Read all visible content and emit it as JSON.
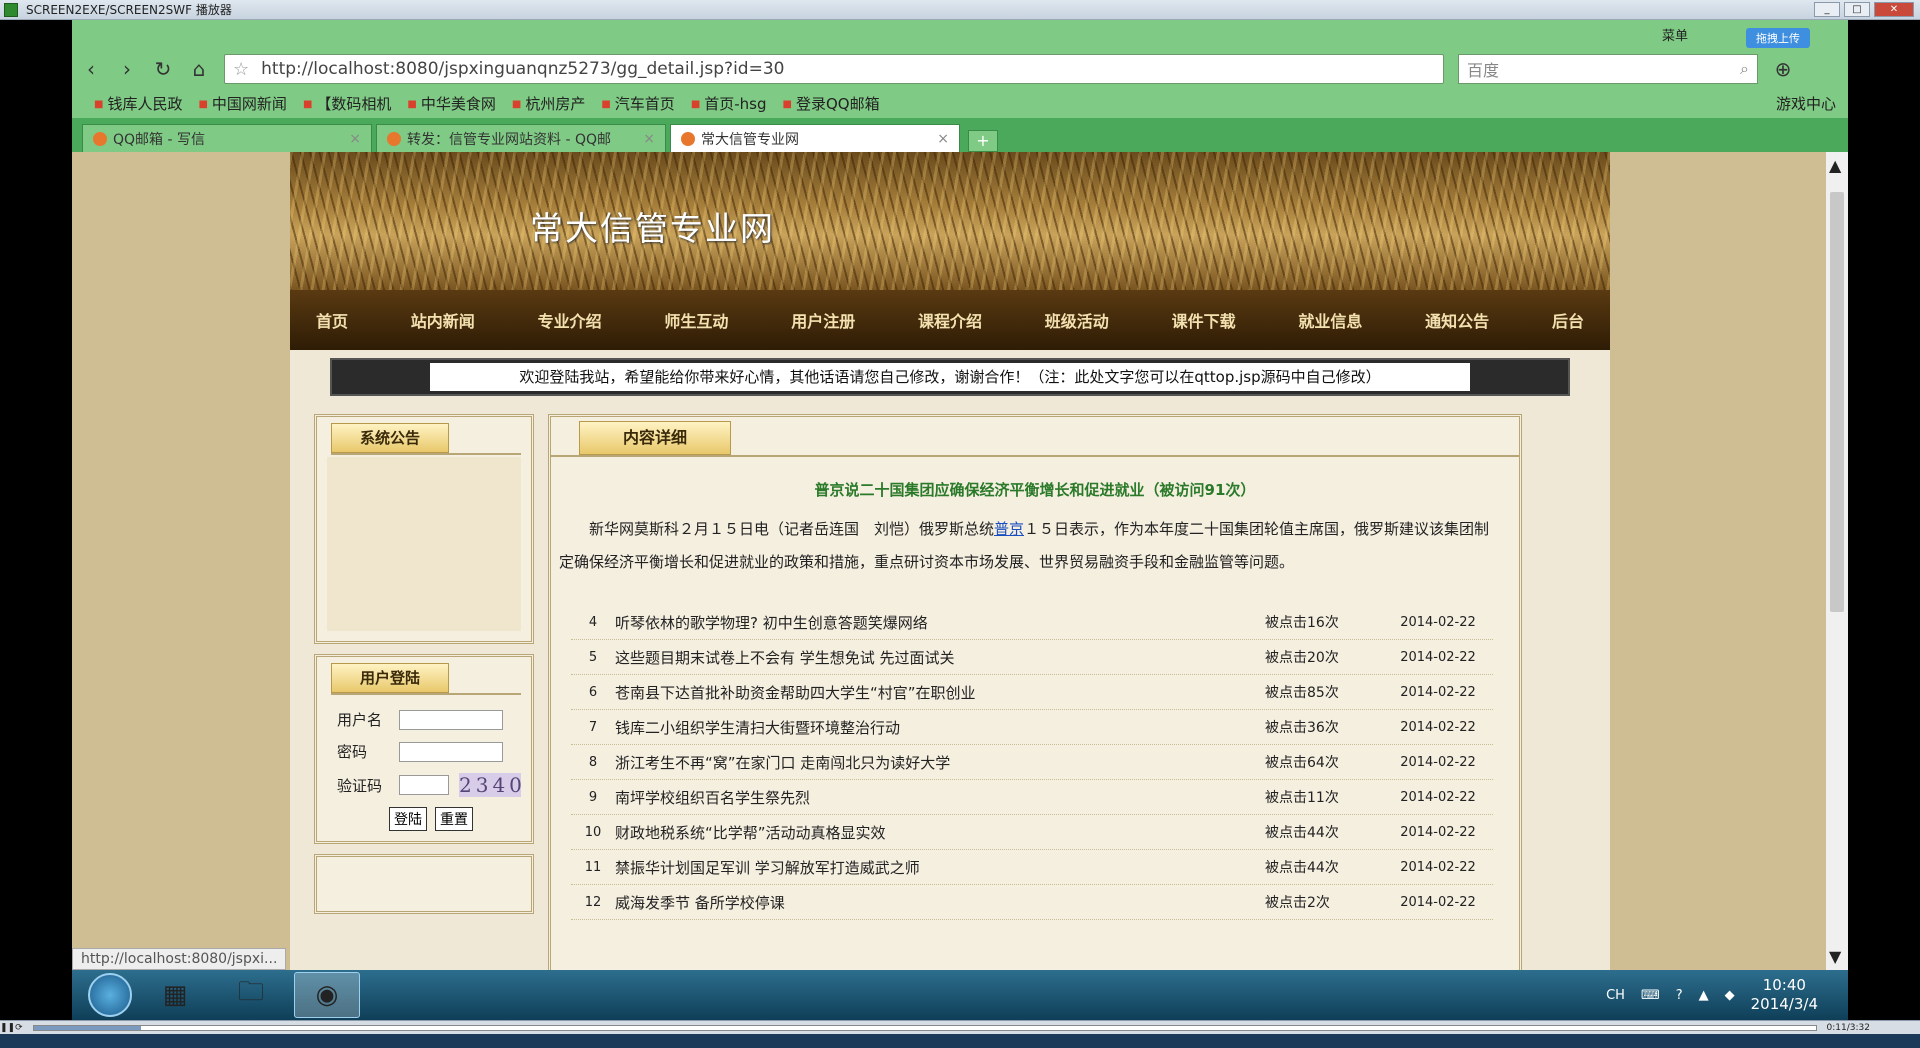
{
  "player": {
    "title": "SCREEN2EXE/SCREEN2SWF 播放器",
    "time": "0:11/3:32"
  },
  "browser": {
    "menu_label": "菜单",
    "upload_label": "拖拽上传",
    "url": "http://localhost:8080/jspxinguanqnz5273/gg_detail.jsp?id=30",
    "search_placeholder": "百度",
    "bookmarks": [
      "钱库人民政",
      "中国网新闻",
      "【数码相机",
      "中华美食网",
      "杭州房产",
      "汽车首页",
      "首页-hsg",
      "登录QQ邮箱"
    ],
    "games_label": "游戏中心",
    "tabs": [
      {
        "label": "QQ邮箱 - 写信",
        "active": false
      },
      {
        "label": "转发：信管专业网站资料 - QQ邮",
        "active": false
      },
      {
        "label": "常大信管专业网",
        "active": true
      }
    ],
    "status_url": "http://localhost:8080/jspxi..."
  },
  "site": {
    "title": "常大信管专业网",
    "nav": [
      "首页",
      "站内新闻",
      "专业介绍",
      "师生互动",
      "用户注册",
      "课程介绍",
      "班级活动",
      "课件下载",
      "就业信息",
      "通知公告",
      "后台"
    ],
    "notice": "欢迎登陆我站，希望能给你带来好心情，其他话语请您自己修改，谢谢合作！（注：此处文字您可以在qttop.jsp源码中自己修改）",
    "announce_tab": "系统公告",
    "login": {
      "tab": "用户登陆",
      "username_label": "用户名",
      "password_label": "密码",
      "captcha_label": "验证码",
      "captcha_value": "2340",
      "login_button": "登陆",
      "reset_button": "重置"
    },
    "content": {
      "tab": "内容详细",
      "article_title": "普京说二十国集团应确保经济平衡增长和促进就业（被访问91次）",
      "body_before": "新华网莫斯科２月１５日电（记者岳连国　刘恺）俄罗斯总统",
      "body_link": "普京",
      "body_after": "１５日表示，作为本年度二十国集团轮值主席国，俄罗斯建议该集团制定确保经济平衡增长和促进就业的政策和措施，重点研讨资本市场发展、世界贸易融资手段和金融监管等问题。",
      "news": [
        {
          "num": "4",
          "title": "听琴依林的歌学物理? 初中生创意答题笑爆网络",
          "hits": "被点击16次",
          "date": "2014-02-22"
        },
        {
          "num": "5",
          "title": "这些题目期末试卷上不会有  学生想免试  先过面试关",
          "hits": "被点击20次",
          "date": "2014-02-22"
        },
        {
          "num": "6",
          "title": "苍南县下达首批补助资金帮助四大学生“村官”在职创业",
          "hits": "被点击85次",
          "date": "2014-02-22"
        },
        {
          "num": "7",
          "title": "钱库二小组织学生清扫大街暨环境整治行动",
          "hits": "被点击36次",
          "date": "2014-02-22"
        },
        {
          "num": "8",
          "title": "浙江考生不再“窝”在家门口  走南闯北只为读好大学",
          "hits": "被点击64次",
          "date": "2014-02-22"
        },
        {
          "num": "9",
          "title": "南坪学校组织百名学生祭先烈",
          "hits": "被点击11次",
          "date": "2014-02-22"
        },
        {
          "num": "10",
          "title": "财政地税系统“比学帮”活动动真格显实效",
          "hits": "被点击44次",
          "date": "2014-02-22"
        },
        {
          "num": "11",
          "title": "禁振华计划国足军训  学习解放军打造威武之师",
          "hits": "被点击44次",
          "date": "2014-02-22"
        },
        {
          "num": "12",
          "title": "威海发季节  备所学校停课",
          "hits": "被点击2次",
          "date": "2014-02-22"
        }
      ]
    }
  },
  "taskbar": {
    "lang": "CH",
    "time": "10:40",
    "date": "2014/3/4"
  }
}
